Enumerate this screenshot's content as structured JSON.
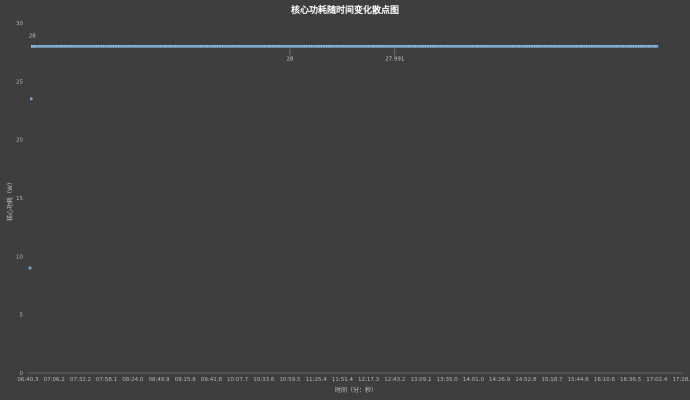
{
  "chart_data": {
    "type": "scatter",
    "title": "核心功耗随时间变化散点图",
    "xlabel": "时间（分：秒）",
    "ylabel": "核心功耗（W）",
    "ylim": [
      0,
      30
    ],
    "yticks": [
      "0",
      "5",
      "10",
      "15",
      "20",
      "25",
      "30"
    ],
    "xticks": [
      "06:40.3",
      "07:06.2",
      "07:32.2",
      "07:58.1",
      "08:24.0",
      "08:49.9",
      "09:15.8",
      "09:41.8",
      "10:07.7",
      "10:33.6",
      "10:59.5",
      "11:25.4",
      "11:51.4",
      "12:17.3",
      "12:43.2",
      "13:09.1",
      "13:35.0",
      "14:01.0",
      "14:26.9",
      "14:52.8",
      "15:18.7",
      "15:44.6",
      "16:10.6",
      "16:36.5",
      "17:02.4",
      "17:28.3"
    ],
    "xlim_seconds": [
      400.3,
      1048.3
    ],
    "grid": false,
    "color": "#5b9bd5",
    "series": [
      {
        "x_start": "06:42.3",
        "x_end": "17:02.4",
        "points": [
          {
            "x": "06:42.3",
            "y": 9
          },
          {
            "x": "06:43.5",
            "y": 23.5
          },
          {
            "x": "06:44.5",
            "y": 28,
            "label": "28"
          },
          {
            "x": "06:45.5",
            "y": 28
          },
          {
            "x": "17:02.4",
            "y": 28
          }
        ],
        "steady_value": 28
      }
    ],
    "annotations": [
      {
        "text": "28",
        "x": "10:59.5",
        "y": 28
      },
      {
        "text": "27.991",
        "x": "12:43.2",
        "y": 27.991
      }
    ]
  }
}
